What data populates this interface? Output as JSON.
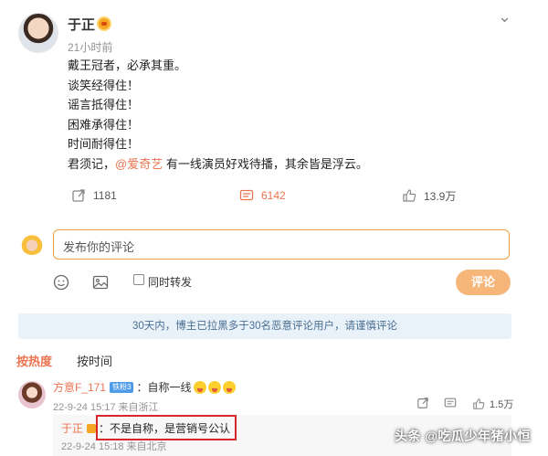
{
  "post": {
    "author": "于正",
    "time": "21小时前",
    "lines": [
      "戴王冠者，必承其重。",
      "谈笑经得住！",
      "谣言抵得住！",
      "困难承得住！",
      "时间耐得住！"
    ],
    "last_line_prefix": "君须记，",
    "mention": "@爱奇艺",
    "last_line_suffix": " 有一线演员好戏待播，其余皆是浮云。"
  },
  "actions": {
    "reposts": "1181",
    "comments": "6142",
    "likes": "13.9万"
  },
  "composer": {
    "placeholder": "发布你的评论",
    "repost_label": "同时转发",
    "submit_label": "评论"
  },
  "notice": "30天内，博主已拉黑多于30名恶意评论用户，请谨慎评论",
  "tabs": {
    "hot": "按热度",
    "time": "按时间"
  },
  "comment": {
    "user": "方意F_171",
    "badge": "铁粉3",
    "separator": "：",
    "text": "自称一线",
    "meta": "22-9-24 15:17 来自浙江",
    "likes": "1.5万"
  },
  "reply": {
    "user": "于正",
    "separator": "：",
    "text": "不是自称，是营销号公认",
    "meta": "22-9-24 15:18 来自北京"
  },
  "watermark": "头条 @吃瓜少年猪小恒",
  "colors": {
    "accent": "#eb7350",
    "notice_bg": "#e9f1f9",
    "highlight": "#d8262b"
  }
}
